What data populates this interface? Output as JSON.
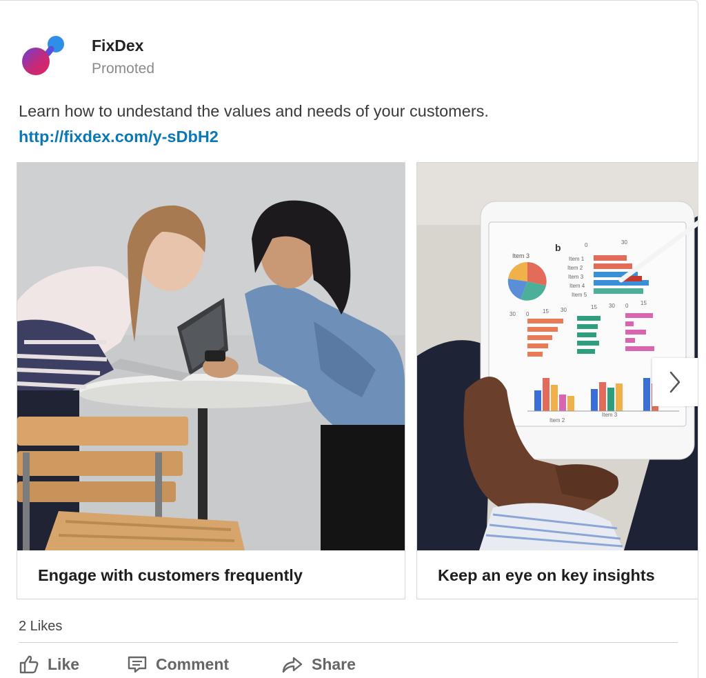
{
  "post": {
    "author": "FixDex",
    "label": "Promoted",
    "text": "Learn how to undestand the values and needs of your customers. ",
    "link_text": "http://fixdex.com/y-sDbH2",
    "logo_icon": "fixdex-logo",
    "brand_colors": {
      "logo_top": "#2f8fe8",
      "logo_bottom": "#e0245e",
      "link": "#0a78b4"
    }
  },
  "carousel": {
    "slides": [
      {
        "caption": "Engage with customers frequently",
        "image": "two-women-laptop-photo"
      },
      {
        "caption": "Keep an eye on key insights",
        "image": "tablet-charts-photo"
      }
    ],
    "tablet_screen": {
      "heading": "b",
      "pie_label": "Item 3",
      "item_labels": [
        "Item 1",
        "Item 2",
        "Item 3",
        "Item 4",
        "Item 5"
      ],
      "top_axis": [
        "0",
        "30"
      ],
      "axis_a": [
        "30",
        "0",
        "15",
        "30"
      ],
      "axis_b": [
        "15",
        "30"
      ],
      "axis_c": [
        "0",
        "15"
      ],
      "bottom_labels": [
        "Item 2",
        "Item 3"
      ]
    },
    "next_icon": "chevron-right-icon"
  },
  "social": {
    "likes": "2 Likes",
    "actions": [
      {
        "label": "Like",
        "icon": "thumbs-up-icon"
      },
      {
        "label": "Comment",
        "icon": "comment-icon"
      },
      {
        "label": "Share",
        "icon": "share-arrow-icon"
      }
    ]
  }
}
